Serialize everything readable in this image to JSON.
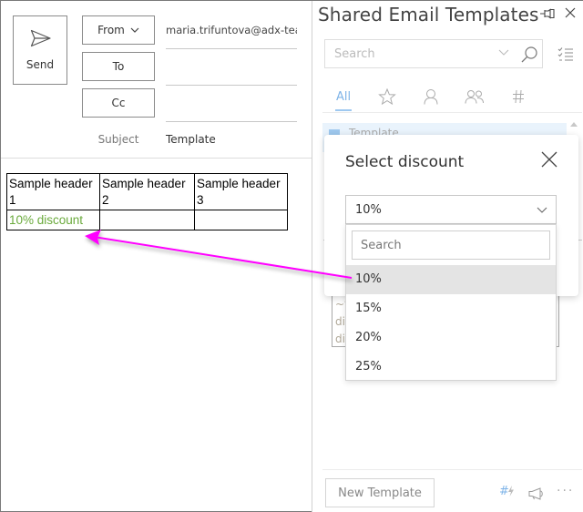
{
  "compose": {
    "send_label": "Send",
    "from_label": "From",
    "to_label": "To",
    "cc_label": "Cc",
    "from_value": "maria.trifuntova@adx-team",
    "to_value": "",
    "cc_value": "",
    "subject_label": "Subject",
    "subject_value": "Template",
    "table": {
      "headers": [
        "Sample header 1",
        "Sample header 2",
        "Sample header 3"
      ],
      "header_lines": [
        [
          "Sample header",
          "1"
        ],
        [
          "Sample header",
          "2"
        ],
        [
          "Sample header",
          "3"
        ]
      ],
      "rows": [
        [
          "10% discount",
          "",
          ""
        ]
      ],
      "highlight_color": "#6aaa3c"
    }
  },
  "panel": {
    "title": "Shared Email Templates",
    "search_placeholder": "Search",
    "tabs": [
      {
        "label": "All",
        "icon": "all",
        "active": true
      },
      {
        "label": "",
        "icon": "star-icon"
      },
      {
        "label": "",
        "icon": "person-icon"
      },
      {
        "label": "",
        "icon": "people-icon"
      },
      {
        "label": "",
        "icon": "hashtag-icon"
      }
    ],
    "list_item_partial": "Template",
    "preview_lines": [
      "~%",
      "di",
      "di"
    ],
    "new_template_label": "New Template",
    "footer_hash": "#",
    "more_label": "···",
    "accent_color": "#7fb4e8"
  },
  "dialog": {
    "title": "Select discount",
    "selected_value": "10%",
    "dropdown_search_placeholder": "Search",
    "options": [
      "10%",
      "15%",
      "20%",
      "25%"
    ],
    "highlighted_option": "10%"
  },
  "annotation": {
    "arrow_color": "#ff00ff"
  }
}
